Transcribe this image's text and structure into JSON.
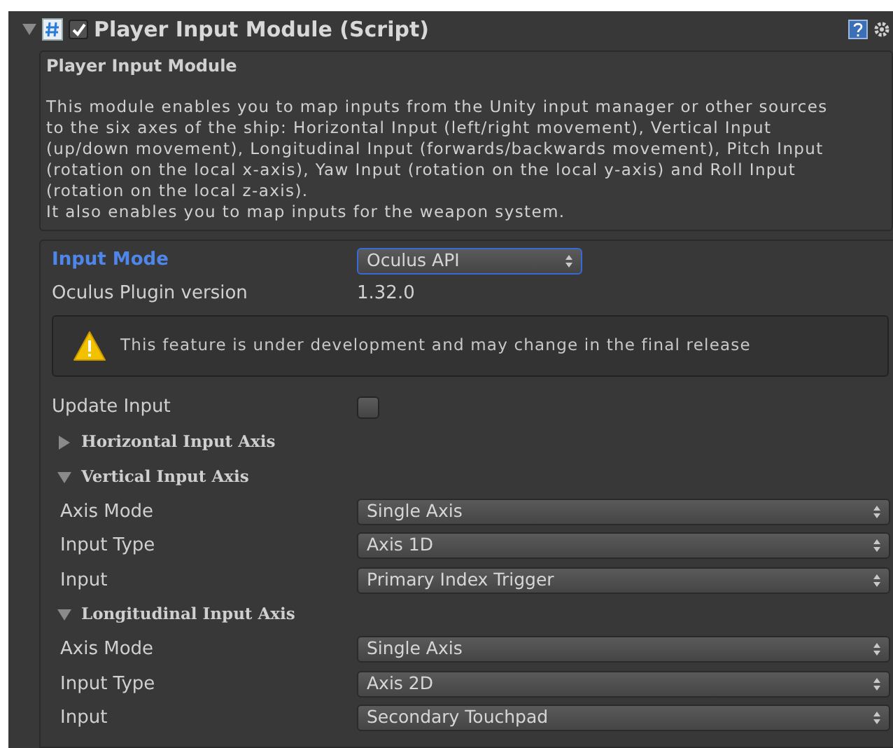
{
  "component": {
    "enabled": true,
    "title": "Player Input Module (Script)"
  },
  "description": {
    "title": "Player Input Module",
    "lines": [
      "This module enables you to map inputs from the Unity input manager or other sources",
      "to the six axes of the ship: Horizontal Input (left/right movement), Vertical Input",
      "(up/down movement), Longitudinal Input (forwards/backwards movement), Pitch Input",
      "(rotation on the local x-axis), Yaw Input (rotation on the local y-axis) and Roll Input",
      "(rotation on the local z-axis).",
      "It also enables you to map inputs for the weapon system."
    ]
  },
  "input_mode": {
    "label": "Input Mode",
    "value": "Oculus API"
  },
  "plugin_version": {
    "label": "Oculus Plugin version",
    "value": "1.32.0"
  },
  "warning": "This feature is under development and may change in the final release",
  "update_input": {
    "label": "Update Input",
    "checked": false
  },
  "axes": [
    {
      "title": "Horizontal Input Axis",
      "expanded": false
    },
    {
      "title": "Vertical Input Axis",
      "expanded": true,
      "fields": [
        {
          "label": "Axis Mode",
          "value": "Single Axis"
        },
        {
          "label": "Input Type",
          "value": "Axis 1D"
        },
        {
          "label": "Input",
          "value": "Primary Index Trigger"
        }
      ]
    },
    {
      "title": "Longitudinal Input Axis",
      "expanded": true,
      "fields": [
        {
          "label": "Axis Mode",
          "value": "Single Axis"
        },
        {
          "label": "Input Type",
          "value": "Axis 2D"
        },
        {
          "label": "Input",
          "value": "Secondary Touchpad"
        }
      ]
    }
  ]
}
